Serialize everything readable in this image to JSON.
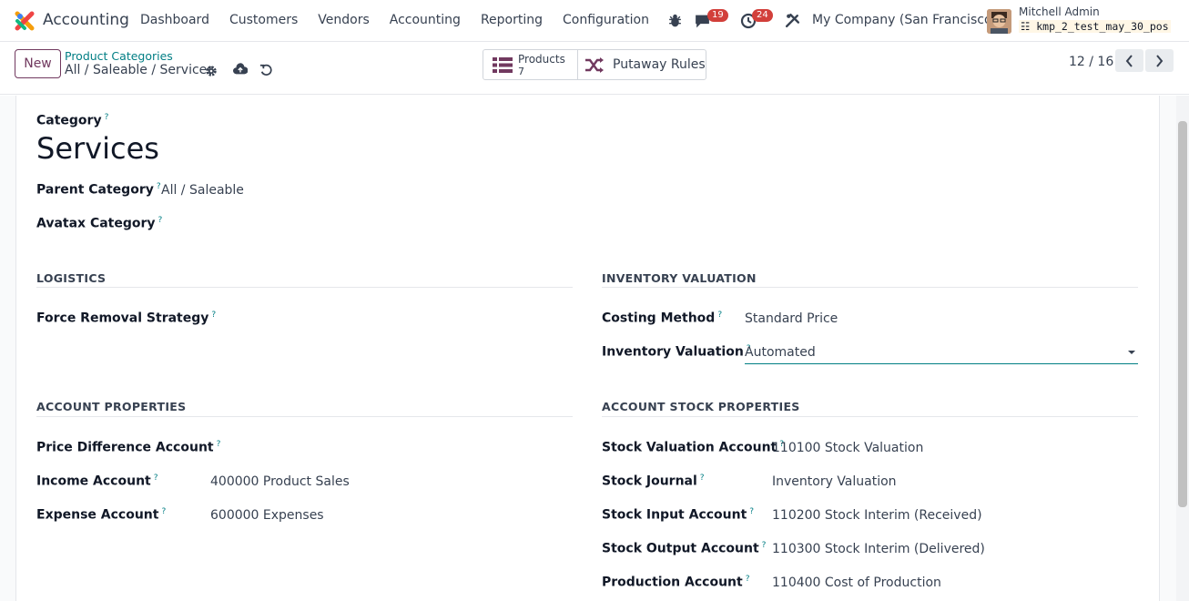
{
  "navbar": {
    "app_name": "Accounting",
    "menu": [
      "Dashboard",
      "Customers",
      "Vendors",
      "Accounting",
      "Reporting",
      "Configuration"
    ],
    "messages_badge": "19",
    "activities_badge": "24",
    "company": "My Company (San Francisco)",
    "user_name": "Mitchell Admin",
    "db_name": "kmp_2_test_may_30_pos"
  },
  "control": {
    "new_label": "New",
    "breadcrumb_parent": "Product Categories",
    "breadcrumb_current": "All / Saleable / Services",
    "products_label": "Products",
    "products_count": "7",
    "putaway_label": "Putaway Rules",
    "pager": "12 / 16"
  },
  "form": {
    "category_label": "Category",
    "category_name": "Services",
    "parent_label": "Parent Category",
    "parent_value": "All / Saleable",
    "avatax_label": "Avatax Category",
    "help": "?",
    "logistics": {
      "title": "LOGISTICS",
      "removal_label": "Force Removal Strategy"
    },
    "inventory_valuation": {
      "title": "INVENTORY VALUATION",
      "costing_label": "Costing Method",
      "costing_value": "Standard Price",
      "valuation_label": "Inventory Valuation",
      "valuation_value": "Automated"
    },
    "account_properties": {
      "title": "ACCOUNT PROPERTIES",
      "price_diff_label": "Price Difference Account",
      "income_label": "Income Account",
      "income_value": "400000 Product Sales",
      "expense_label": "Expense Account",
      "expense_value": "600000 Expenses"
    },
    "stock_properties": {
      "title": "ACCOUNT STOCK PROPERTIES",
      "valuation_account_label": "Stock Valuation Account",
      "valuation_account_value": "110100 Stock Valuation",
      "journal_label": "Stock Journal",
      "journal_value": "Inventory Valuation",
      "input_label": "Stock Input Account",
      "input_value": "110200 Stock Interim (Received)",
      "output_label": "Stock Output Account",
      "output_value": "110300 Stock Interim (Delivered)",
      "production_label": "Production Account",
      "production_value": "110400 Cost of Production"
    }
  },
  "icons": {
    "debug": "bug-icon",
    "messages": "chat-icon",
    "activities": "clock-icon",
    "tools": "tools-icon",
    "settings": "gear-icon",
    "save": "cloud-upload-icon",
    "discard": "undo-icon",
    "products": "list-icon",
    "putaway": "shuffle-icon",
    "prev": "chevron-left-icon",
    "next": "chevron-right-icon"
  },
  "colors": {
    "brand": "#71395f",
    "accent": "#017e84",
    "badge": "#d23f3a"
  }
}
